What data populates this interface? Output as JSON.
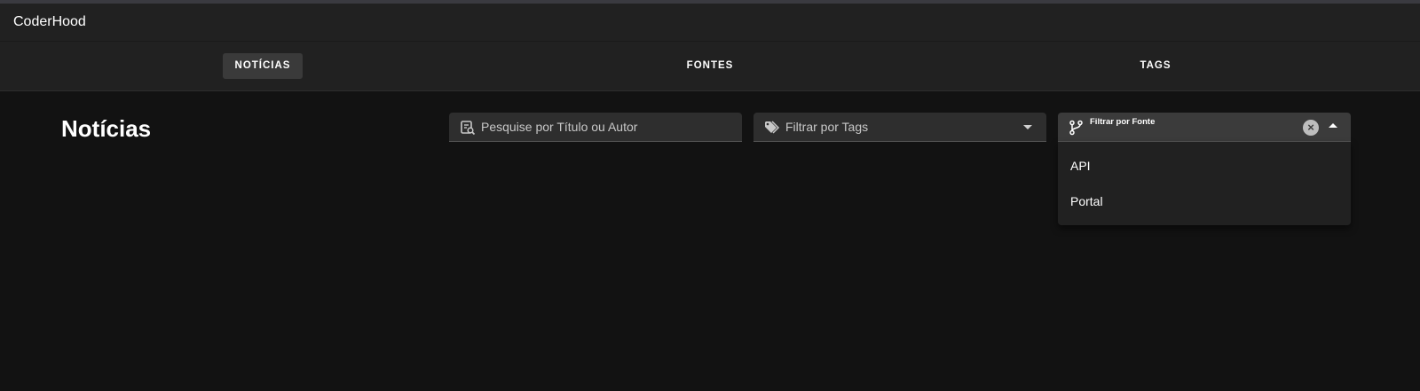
{
  "app": {
    "title": "CoderHood"
  },
  "tabs": [
    {
      "label": "NOTÍCIAS",
      "active": true
    },
    {
      "label": "FONTES",
      "active": false
    },
    {
      "label": "TAGS",
      "active": false
    }
  ],
  "page": {
    "title": "Notícias"
  },
  "filters": {
    "search": {
      "placeholder": "Pesquise por Título ou Autor",
      "icon": "search-list-icon"
    },
    "tags": {
      "placeholder": "Filtrar por Tags",
      "icon": "tags-icon"
    },
    "source": {
      "label": "Filtrar por Fonte",
      "icon": "source-branch-icon",
      "options": [
        "API",
        "Portal"
      ]
    }
  }
}
